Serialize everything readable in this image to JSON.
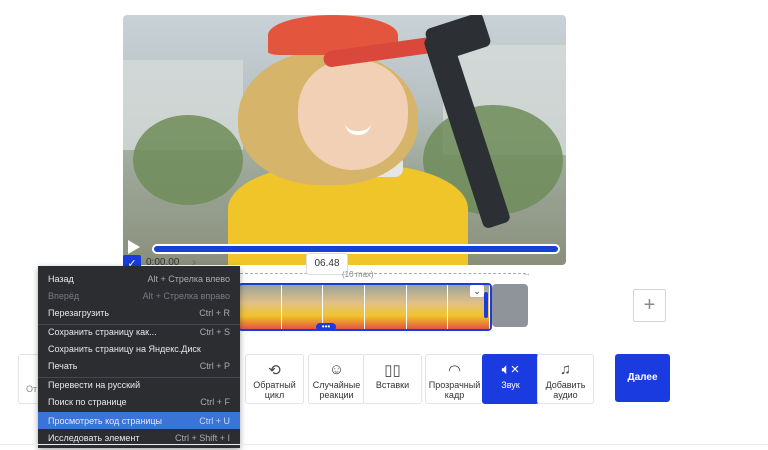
{
  "video": {
    "time_start": "0:00.00",
    "time_center": "06.48",
    "max_label": "(10 max)"
  },
  "context_menu": {
    "items": [
      {
        "label": "Назад",
        "shortcut": "Alt + Стрелка влево",
        "disabled": false
      },
      {
        "label": "Вперёд",
        "shortcut": "Alt + Стрелка вправо",
        "disabled": true
      },
      {
        "label": "Перезагрузить",
        "shortcut": "Ctrl + R",
        "disabled": false
      },
      {
        "label": "Сохранить страницу как...",
        "shortcut": "Ctrl + S",
        "disabled": false
      },
      {
        "label": "Сохранить страницу на Яндекс.Диск",
        "shortcut": "",
        "disabled": false
      },
      {
        "label": "Печать",
        "shortcut": "Ctrl + P",
        "disabled": false
      },
      {
        "label": "Перевести на русский",
        "shortcut": "",
        "disabled": false
      },
      {
        "label": "Поиск по странице",
        "shortcut": "Ctrl + F",
        "disabled": false
      },
      {
        "label": "Просмотреть код страницы",
        "shortcut": "Ctrl + U",
        "disabled": false
      },
      {
        "label": "Исследовать элемент",
        "shortcut": "Ctrl + Shift + I",
        "disabled": false
      }
    ]
  },
  "tools": {
    "partial_label": "От",
    "reverse_loop": "Обратный цикл",
    "random_reactions": "Случайные реакции",
    "inserts": "Вставки",
    "transparent_frame": "Прозрачный кадр",
    "sound": "Звук",
    "add_audio": "Добавить аудио"
  },
  "buttons": {
    "next": "Далее",
    "add": "+"
  },
  "icons": {
    "play": "play-icon",
    "check": "check-icon",
    "chevron_right": "chevron-right-icon",
    "reverse": "reverse-loop-icon",
    "reactions": "reactions-icon",
    "inserts": "inserts-icon",
    "ghost": "ghost-icon",
    "sound": "speaker-mute-icon",
    "music": "music-note-icon"
  },
  "colors": {
    "accent": "#1a3be0",
    "menu_bg": "#2b2d31",
    "menu_highlight": "#3a74d6"
  }
}
